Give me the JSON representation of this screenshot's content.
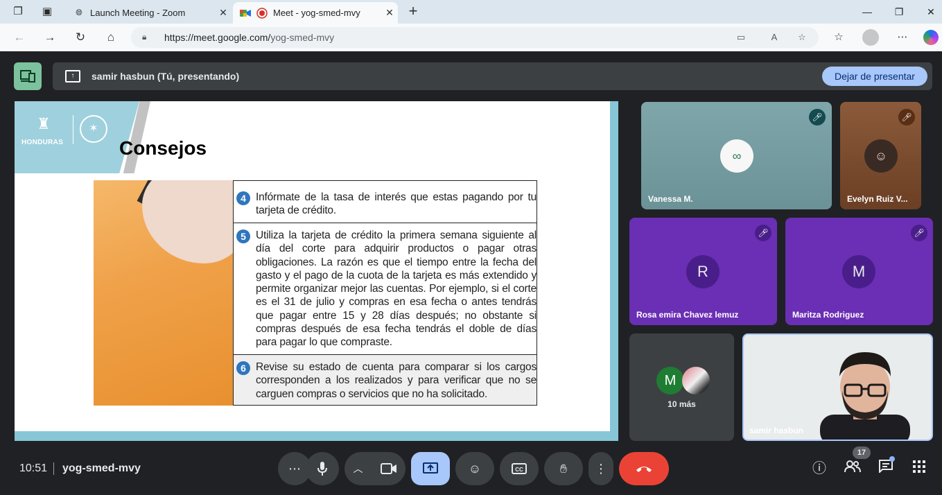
{
  "browser": {
    "tabs": [
      {
        "title": "Launch Meeting - Zoom",
        "active": false
      },
      {
        "title": "Meet - yog-smed-mvy",
        "active": true
      }
    ],
    "url_host": "https://meet.google.com/",
    "url_path": "yog-smed-mvy"
  },
  "presentation": {
    "banner_label": "samir hasbun (Tú, presentando)",
    "stop_label": "Dejar de presentar"
  },
  "slide": {
    "logo_text": "HONDURAS",
    "title": "Consejos",
    "tips": [
      {
        "number": "4",
        "text": "Infórmate de la tasa de interés que estas pagando por tu tarjeta de crédito."
      },
      {
        "number": "5",
        "text": "Utiliza la tarjeta de crédito la primera semana siguiente al día del corte para adquirir productos o pagar otras obligaciones. La razón es que el tiempo entre la fecha del gasto y el pago de la cuota de la tarjeta es más extendido y permite organizar mejor las cuentas. Por ejemplo, si el corte es el 31 de julio y compras en esa fecha o antes tendrás que pagar entre 15 y 28 días después; no obstante si compras después de esa fecha tendrás el doble de días para pagar lo que compraste."
      },
      {
        "number": "6",
        "text": "Revise su estado de cuenta para comparar si los cargos corresponden a los realizados y para verificar que no se carguen compras o servicios que no ha solicitado."
      }
    ]
  },
  "participants": {
    "vanessa": {
      "name": "Vanessa M."
    },
    "evelyn": {
      "name": "Evelyn Ruiz V..."
    },
    "rosa": {
      "name": "Rosa emira Chavez lemuz",
      "initial": "R"
    },
    "maritza": {
      "name": "Maritza Rodriguez",
      "initial": "M"
    },
    "more": {
      "initial": "M",
      "label": "10 más"
    },
    "self": {
      "name": "samir hasbun"
    }
  },
  "bottom": {
    "time": "10:51",
    "meeting_code": "yog-smed-mvy",
    "participant_count": "17"
  },
  "colors": {
    "accent_blue": "#a8c7fa",
    "end_call_red": "#ea4335",
    "tile_purple": "#6a2fb4",
    "presenting_green": "#7cc29e"
  }
}
